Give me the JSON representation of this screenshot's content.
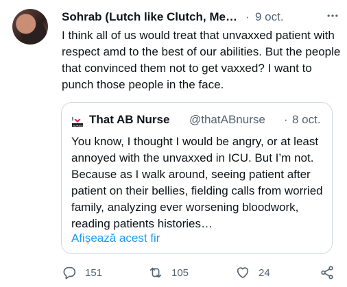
{
  "tweet": {
    "author": "Sohrab (Lutch like Clutch, Medial ...",
    "separator": "·",
    "date": "9 oct.",
    "text": "I think all of us would treat that unvaxxed patient with respect amd to the best of our abilities. But the people that convinced them not to get vaxxed? I want to punch those people  in the face."
  },
  "quote": {
    "logo_text": "I ♥ NURSES",
    "name": "That AB Nurse",
    "handle": "@thatABnurse",
    "separator": "·",
    "date": "8 oct.",
    "text": "You know, I thought I would be angry, or at least annoyed with the unvaxxed in ICU. But I’m not. Because as I walk around, seeing patient after patient on their bellies, fielding calls from worried family, analyzing ever worsening bloodwork, reading patients histories…",
    "show_more": "Afișează acest fir"
  },
  "actions": {
    "replies": "151",
    "retweets": "105",
    "likes": "24"
  },
  "colors": {
    "text": "#0f1419",
    "secondary": "#536471",
    "link": "#1d9bf0",
    "border": "#cfd9de"
  }
}
